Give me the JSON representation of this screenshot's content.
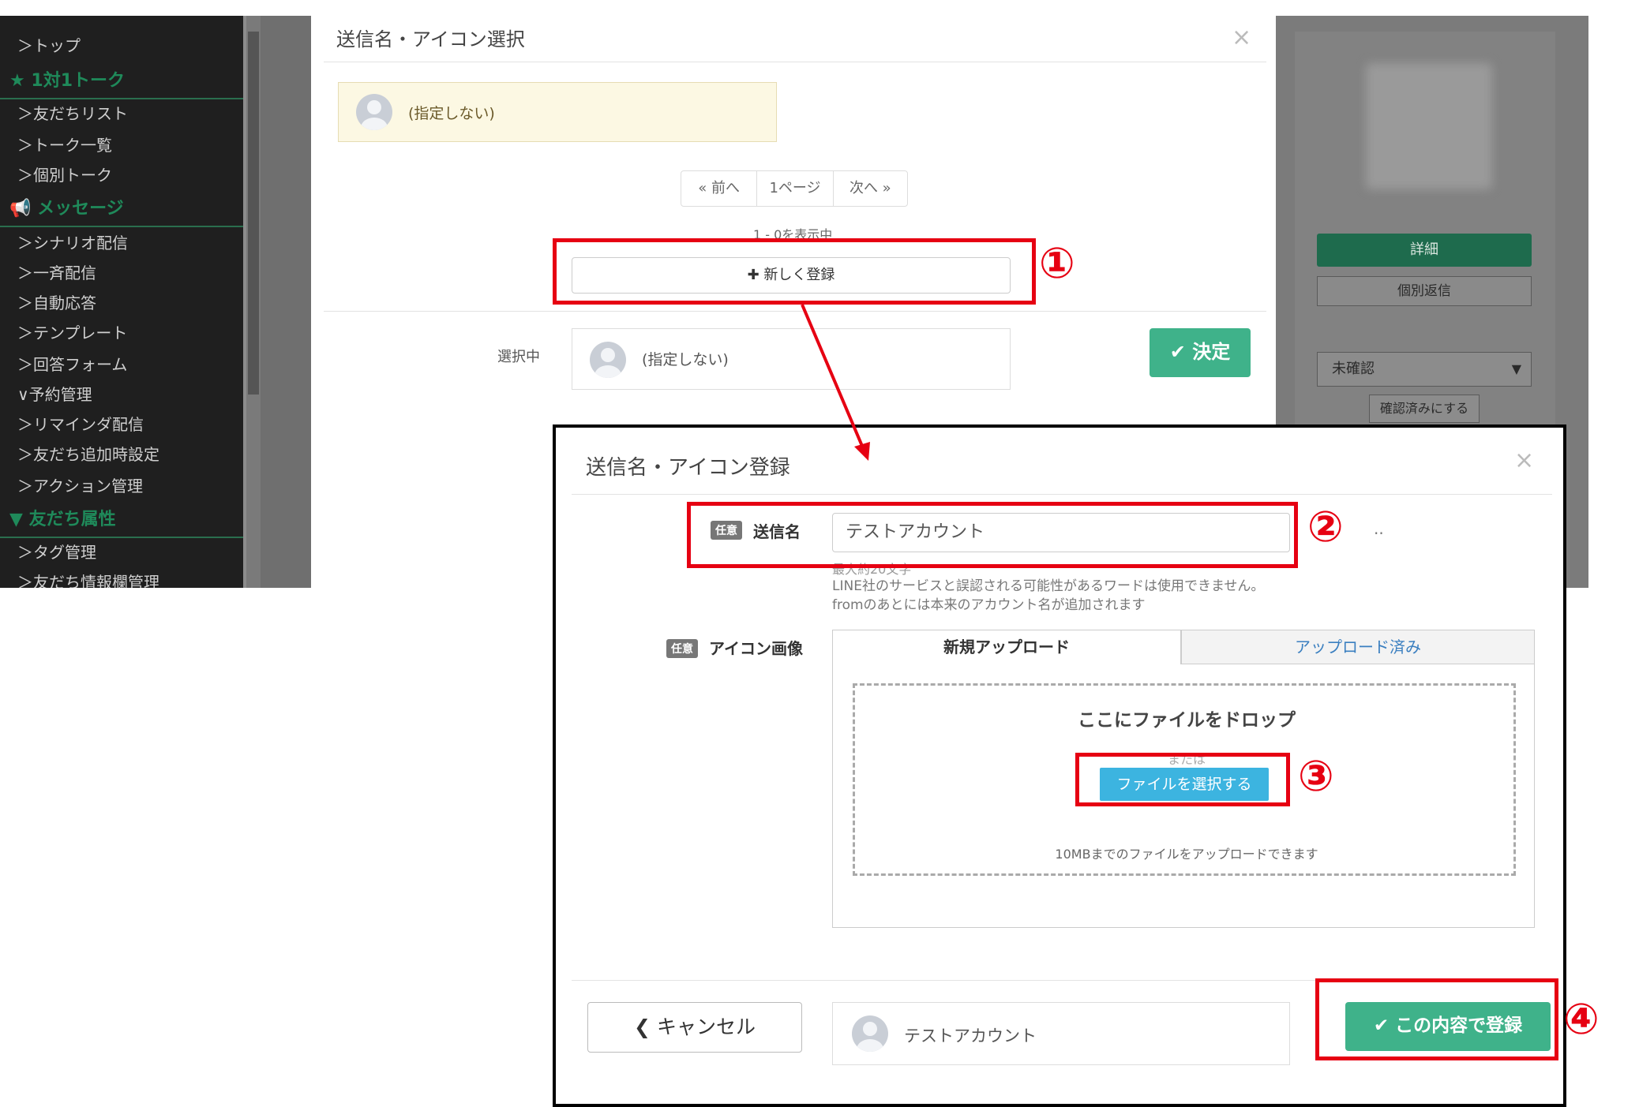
{
  "sidebar": {
    "items": [
      {
        "label": "＞トップ"
      },
      {
        "label": "★ 1対1トーク",
        "heading": true
      },
      {
        "label": "＞友だちリスト"
      },
      {
        "label": "＞トーク一覧"
      },
      {
        "label": "＞個別トーク"
      },
      {
        "label": "メッセージ",
        "heading": true
      },
      {
        "label": "＞シナリオ配信"
      },
      {
        "label": "＞一斉配信"
      },
      {
        "label": "＞自動応答"
      },
      {
        "label": "＞テンプレート"
      },
      {
        "label": "＞回答フォーム"
      },
      {
        "label": "∨予約管理"
      },
      {
        "label": "＞リマインダ配信"
      },
      {
        "label": "＞友だち追加時設定"
      },
      {
        "label": "＞アクション管理"
      },
      {
        "label": "友だち属性",
        "heading": true
      },
      {
        "label": "＞タグ管理"
      },
      {
        "label": "＞友だち情報欄管理"
      }
    ]
  },
  "right_panel": {
    "detail_label": "詳細",
    "reply_label": "個別返信",
    "status_select": "未確認",
    "confirm_label": "確認済みにする"
  },
  "select_modal": {
    "title": "送信名・アイコン選択",
    "close": "×",
    "card_text": "(指定しない)",
    "pager": {
      "prev": "« 前へ",
      "page": "1ページ",
      "next": "次へ »"
    },
    "count_text": "1 - 0を表示中",
    "new_button": "✚ 新しく登録",
    "selected_label": "選択中",
    "selected_value": "(指定しない)",
    "decide_button": "✔ 決定"
  },
  "register_modal": {
    "title": "送信名・アイコン登録",
    "close": "×",
    "optional_badge": "任意",
    "name_label": "送信名",
    "name_value": "テストアカウント",
    "help_line1": "最大約20文字",
    "help_line2": "LINE社のサービスと誤認される可能性があるワードは使用できません。",
    "help_line3": "fromのあとには本来のアカウント名が追加されます",
    "trailing_dots": "..",
    "icon_label": "アイコン画像",
    "tab_new": "新規アップロード",
    "tab_uploaded": "アップロード済み",
    "drop_title": "ここにファイルをドロップ",
    "drop_or": "または",
    "file_button": "ファイルを選択する",
    "drop_note": "10MBまでのファイルをアップロードできます",
    "cancel_button": "❮ キャンセル",
    "preview_name": "テストアカウント",
    "submit_button": "✔ この内容で登録"
  },
  "annotations": {
    "step1": "①",
    "step2": "②",
    "step3": "③",
    "step4": "④",
    "color": "#e60012"
  }
}
